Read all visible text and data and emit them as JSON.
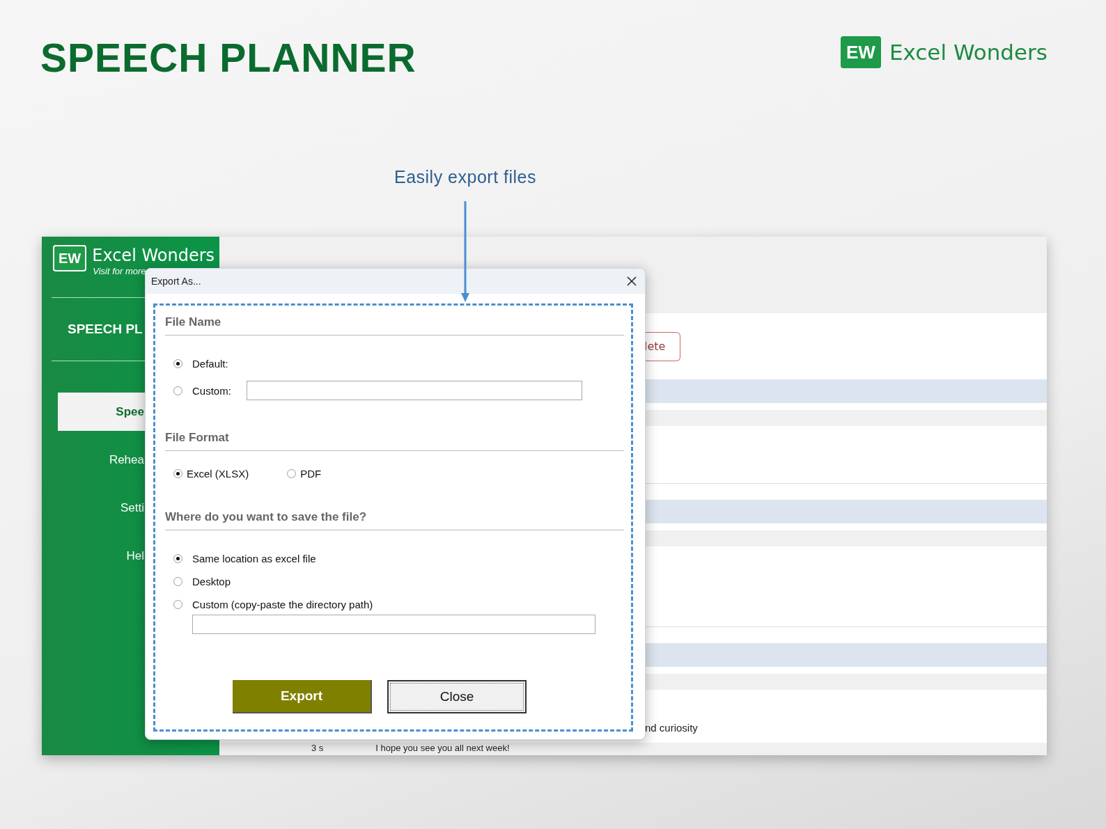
{
  "header": {
    "title": "SPEECH PLANNER",
    "logo_mark": "EW",
    "brand": "Excel Wonders"
  },
  "callout": {
    "text": "Easily export files"
  },
  "sidebar": {
    "logo_mark": "EW",
    "brand": "Excel Wonders",
    "tagline": "Visit for more",
    "title": "SPEECH PL",
    "items": [
      {
        "label": "Spee",
        "selected": true
      },
      {
        "label": "Rehea",
        "selected": false
      },
      {
        "label": "Setti",
        "selected": false
      },
      {
        "label": "Hel",
        "selected": false
      }
    ]
  },
  "main": {
    "delete_button": "lete",
    "row_text": "nd curiosity",
    "bottom_row": {
      "duration": "3 s",
      "text": "I hope you see you all next week!"
    }
  },
  "dialog": {
    "title": "Export As...",
    "sections": [
      {
        "heading": "File Name",
        "kind": "stack",
        "options": [
          {
            "label": "Default:",
            "selected": true,
            "kind": "plain"
          },
          {
            "label": "Custom:",
            "selected": false,
            "kind": "inline_field"
          }
        ]
      },
      {
        "heading": "File Format",
        "kind": "row",
        "options": [
          {
            "label": "Excel (XLSX)",
            "selected": true,
            "kind": "plain"
          },
          {
            "label": "PDF",
            "selected": false,
            "kind": "plain"
          }
        ]
      },
      {
        "heading": "Where do you want to save the file?",
        "kind": "stack",
        "options": [
          {
            "label": "Same location as excel file",
            "selected": true,
            "kind": "plain"
          },
          {
            "label": "Desktop",
            "selected": false,
            "kind": "plain"
          },
          {
            "label": "Custom (copy-paste the directory path)",
            "selected": false,
            "kind": "field_below"
          }
        ]
      }
    ],
    "buttons": [
      {
        "label": "Export",
        "kind": "primary"
      },
      {
        "label": "Close",
        "kind": "secondary"
      }
    ]
  }
}
